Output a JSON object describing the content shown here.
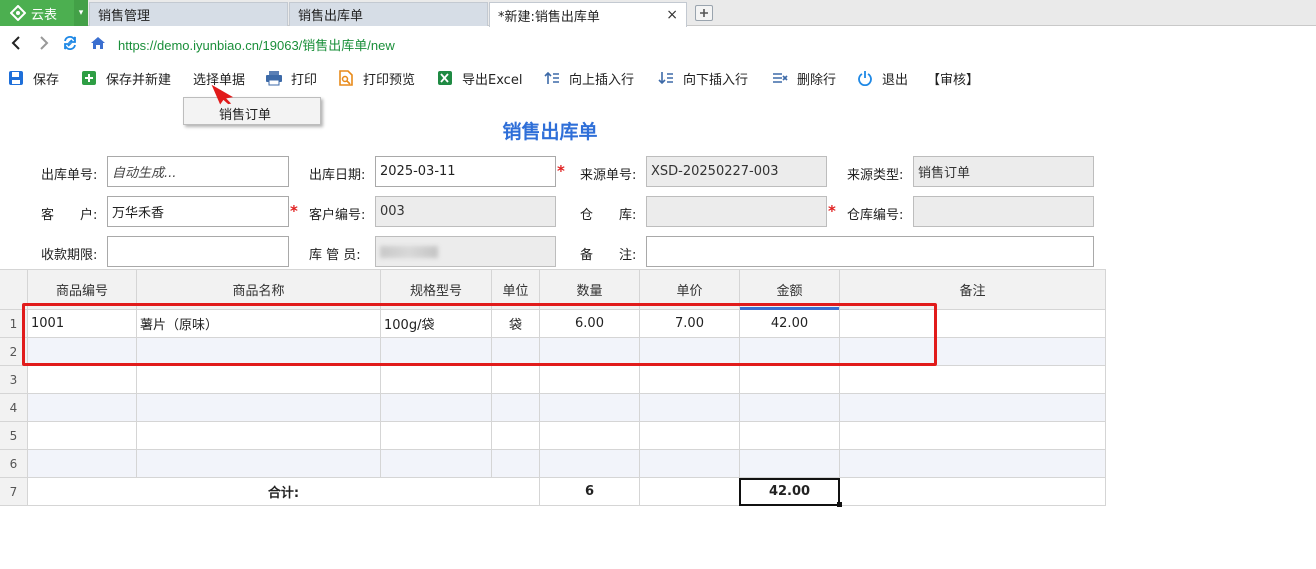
{
  "app": {
    "brand": "云表"
  },
  "tabs": [
    {
      "label": "销售管理"
    },
    {
      "label": "销售出库单"
    },
    {
      "label": "*新建:销售出库单",
      "close": "×"
    }
  ],
  "address": {
    "url": "https://demo.iyunbiao.cn/19063/销售出库单/new"
  },
  "toolbar": {
    "save": "保存",
    "save_new": "保存并新建",
    "select_doc": "选择单据",
    "print": "打印",
    "print_preview": "打印预览",
    "export_excel": "导出Excel",
    "insert_up": "向上插入行",
    "insert_down": "向下插入行",
    "delete_row": "删除行",
    "exit": "退出",
    "audit": "【审核】"
  },
  "dropdown": {
    "item": "销售订单"
  },
  "form": {
    "title": "销售出库单",
    "labels": {
      "doc_no": "出库单号:",
      "date": "出库日期:",
      "source_no": "来源单号:",
      "source_type": "来源类型:",
      "customer": "客　　户:",
      "customer_code": "客户编号:",
      "warehouse": "仓　　库:",
      "warehouse_code": "仓库编号:",
      "payment_term": "收款期限:",
      "keeper": "库 管 员:",
      "remark": "备　　注:"
    },
    "values": {
      "doc_no": "自动生成...",
      "date": "2025-03-11",
      "source_no": "XSD-20250227-003",
      "source_type": "销售订单",
      "customer": "万华禾香",
      "customer_code": "003",
      "warehouse": "",
      "warehouse_code": "",
      "payment_term": "",
      "keeper": "",
      "remark": ""
    }
  },
  "grid": {
    "columns": [
      "商品编号",
      "商品名称",
      "规格型号",
      "单位",
      "数量",
      "单价",
      "金额",
      "备注"
    ],
    "row_numbers": [
      "1",
      "2",
      "3",
      "4",
      "5",
      "6",
      "7"
    ],
    "rows": [
      [
        "1001",
        "薯片（原味）",
        "100g/袋",
        "袋",
        "6.00",
        "7.00",
        "42.00",
        ""
      ],
      [
        "",
        "",
        "",
        "",
        "",
        "",
        "",
        ""
      ],
      [
        "",
        "",
        "",
        "",
        "",
        "",
        "",
        ""
      ],
      [
        "",
        "",
        "",
        "",
        "",
        "",
        "",
        ""
      ],
      [
        "",
        "",
        "",
        "",
        "",
        "",
        "",
        ""
      ],
      [
        "",
        "",
        "",
        "",
        "",
        "",
        "",
        ""
      ]
    ],
    "total": {
      "label": "合计:",
      "qty": "6",
      "amount": "42.00"
    }
  },
  "colors": {
    "brand": "#4caf50",
    "title": "#2f6fd8",
    "url": "#1a8f3a",
    "highlight": "#e11b1b"
  }
}
